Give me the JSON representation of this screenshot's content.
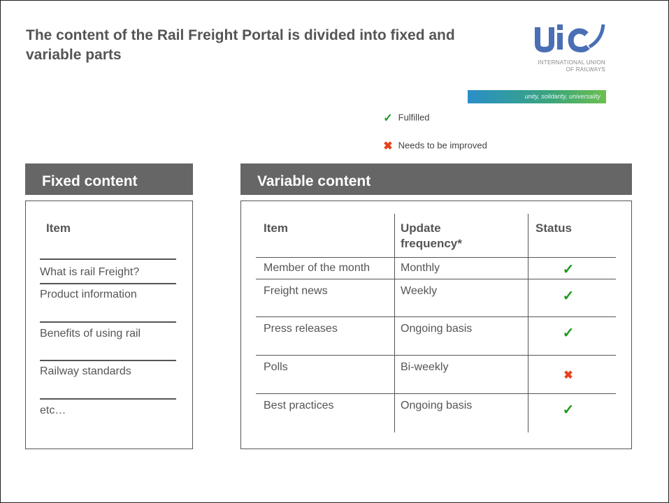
{
  "slide": {
    "title": "The content of the Rail Freight Portal is divided into fixed and variable parts"
  },
  "logo": {
    "mark": "uic",
    "org_line1": "INTERNATIONAL UNION",
    "org_line2": "OF RAILWAYS",
    "slogan": "unity, solidarity, universality",
    "color": "#4a6fb5"
  },
  "legend": {
    "fulfilled_label": "Fulfilled",
    "improve_label": "Needs to be improved",
    "fulfilled_icon": "check-icon",
    "improve_icon": "cross-icon",
    "check_color": "#1a9a1a",
    "cross_color": "#e8401a"
  },
  "fixed": {
    "header": "Fixed content",
    "column": "Item",
    "items": [
      "What is rail Freight?",
      "Product information",
      "Benefits of using rail",
      "Railway standards",
      "etc…"
    ]
  },
  "variable": {
    "header": "Variable content",
    "columns": [
      "Item",
      "Update frequency*",
      "Status"
    ],
    "rows": [
      {
        "item": "Member of the month",
        "frequency": "Monthly",
        "status": "fulfilled"
      },
      {
        "item": "Freight news",
        "frequency": "Weekly",
        "status": "fulfilled"
      },
      {
        "item": "Press releases",
        "frequency": "Ongoing basis",
        "status": "fulfilled"
      },
      {
        "item": "Polls",
        "frequency": "Bi-weekly",
        "status": "needs-improvement"
      },
      {
        "item": "Best practices",
        "frequency": "Ongoing basis",
        "status": "fulfilled"
      }
    ]
  }
}
